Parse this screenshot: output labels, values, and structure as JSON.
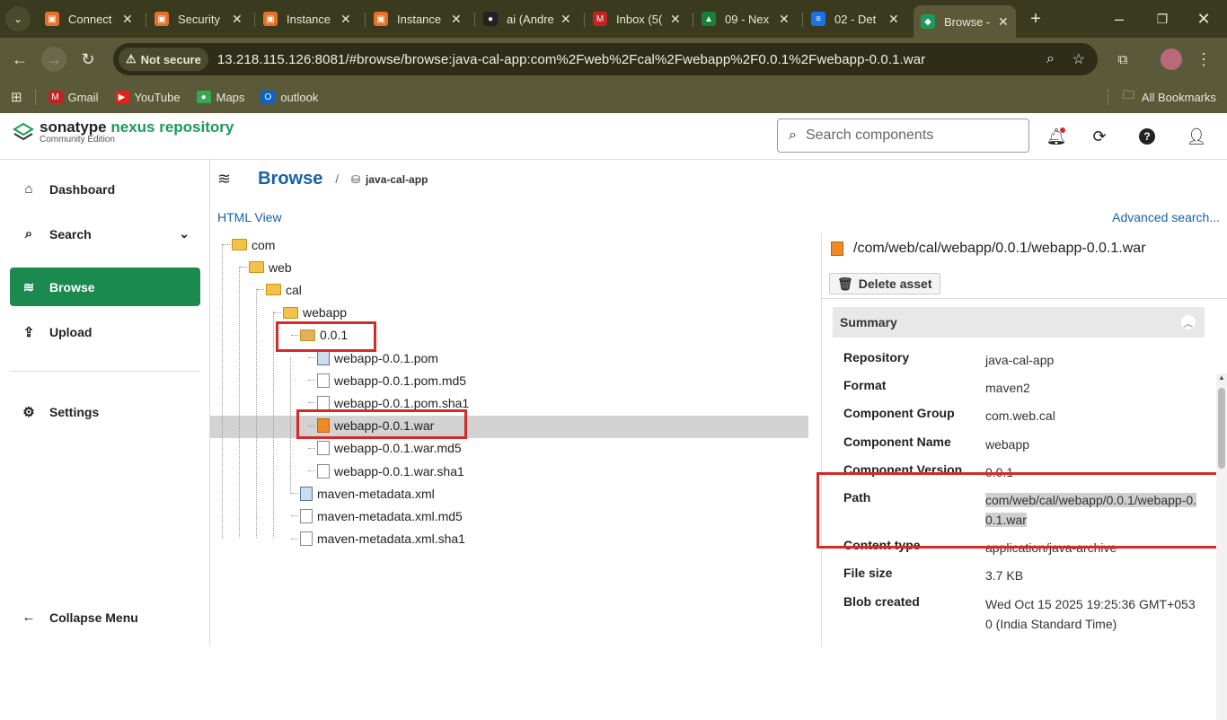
{
  "browser": {
    "tabs": [
      {
        "label": "Connect",
        "color": "#e8702a",
        "glyph": "▣"
      },
      {
        "label": "Security",
        "color": "#e8702a",
        "glyph": "▣"
      },
      {
        "label": "Instance",
        "color": "#e8702a",
        "glyph": "▣"
      },
      {
        "label": "Instance",
        "color": "#e8702a",
        "glyph": "▣"
      },
      {
        "label": "ai (Andre",
        "color": "#222222",
        "glyph": "●"
      },
      {
        "label": "Inbox (5(",
        "color": "#c5221f",
        "glyph": "M"
      },
      {
        "label": "09 - Nex",
        "color": "#188038",
        "glyph": "▲"
      },
      {
        "label": "02 - Det",
        "color": "#1a73e8",
        "glyph": "≡"
      },
      {
        "label": "Browse -",
        "color": "#1b9a5a",
        "glyph": "◆"
      }
    ],
    "new_tab": "+",
    "not_secure": "Not secure",
    "url": "13.218.115.126:8081/#browse/browse:java-cal-app:com%2Fweb%2Fcal%2Fwebapp%2F0.0.1%2Fwebapp-0.0.1.war",
    "bookmarks": [
      {
        "label": "Gmail",
        "icon": "gmail-icon",
        "color": "#c5221f",
        "glyph": "M"
      },
      {
        "label": "YouTube",
        "icon": "youtube-icon",
        "color": "#e62117",
        "glyph": "▶"
      },
      {
        "label": "Maps",
        "icon": "maps-icon",
        "color": "#34a853",
        "glyph": "●"
      },
      {
        "label": "outlook",
        "icon": "outlook-icon",
        "color": "#0a64c8",
        "glyph": "O"
      }
    ],
    "all_bookmarks": "All Bookmarks"
  },
  "app": {
    "brand_a": "sonatype ",
    "brand_b": "nexus repository",
    "edition": "Community Edition",
    "search_placeholder": "Search components"
  },
  "sidebar": {
    "items": [
      {
        "label": "Dashboard",
        "icon": "home-icon"
      },
      {
        "label": "Search",
        "icon": "search-icon"
      },
      {
        "label": "Browse",
        "icon": "database-icon"
      },
      {
        "label": "Upload",
        "icon": "upload-icon"
      },
      {
        "label": "Settings",
        "icon": "gear-icon"
      },
      {
        "label": "Collapse Menu",
        "icon": "arrow-left-icon"
      }
    ]
  },
  "main": {
    "title": "Browse",
    "breadcrumb_sep": "/",
    "repo": "java-cal-app",
    "html_view": "HTML View",
    "advanced_search": "Advanced search..."
  },
  "tree": [
    {
      "label": "com",
      "type": "folder",
      "depth": 0
    },
    {
      "label": "web",
      "type": "folder",
      "depth": 1
    },
    {
      "label": "cal",
      "type": "folder",
      "depth": 2
    },
    {
      "label": "webapp",
      "type": "folder",
      "depth": 3
    },
    {
      "label": "0.0.1",
      "type": "package",
      "depth": 4
    },
    {
      "label": "webapp-0.0.1.pom",
      "type": "pom",
      "depth": 5
    },
    {
      "label": "webapp-0.0.1.pom.md5",
      "type": "file",
      "depth": 5
    },
    {
      "label": "webapp-0.0.1.pom.sha1",
      "type": "file",
      "depth": 5
    },
    {
      "label": "webapp-0.0.1.war",
      "type": "war",
      "depth": 5
    },
    {
      "label": "webapp-0.0.1.war.md5",
      "type": "file",
      "depth": 5
    },
    {
      "label": "webapp-0.0.1.war.sha1",
      "type": "file",
      "depth": 5
    },
    {
      "label": "maven-metadata.xml",
      "type": "pom",
      "depth": 4
    },
    {
      "label": "maven-metadata.xml.md5",
      "type": "file",
      "depth": 4
    },
    {
      "label": "maven-metadata.xml.sha1",
      "type": "file",
      "depth": 4
    }
  ],
  "detail": {
    "path": "/com/web/cal/webapp/0.0.1/webapp-0.0.1.war",
    "delete_label": "Delete asset",
    "summary_label": "Summary",
    "fields": [
      {
        "k": "Repository",
        "v": "java-cal-app"
      },
      {
        "k": "Format",
        "v": "maven2"
      },
      {
        "k": "Component Group",
        "v": "com.web.cal"
      },
      {
        "k": "Component Name",
        "v": "webapp"
      },
      {
        "k": "Component Version",
        "v": "0.0.1"
      },
      {
        "k": "Path",
        "v": "com/web/cal/webapp/0.0.1/webapp-0.0.1.war"
      },
      {
        "k": "Content type",
        "v": "application/java-archive"
      },
      {
        "k": "File size",
        "v": "3.7 KB"
      },
      {
        "k": "Blob created",
        "v": "Wed Oct 15 2025 19:25:36 GMT+0530 (India Standard Time)"
      }
    ]
  },
  "colors": {
    "accent": "#1b8a4e",
    "link": "#1761a8",
    "highlight_box": "#d42a2a"
  }
}
